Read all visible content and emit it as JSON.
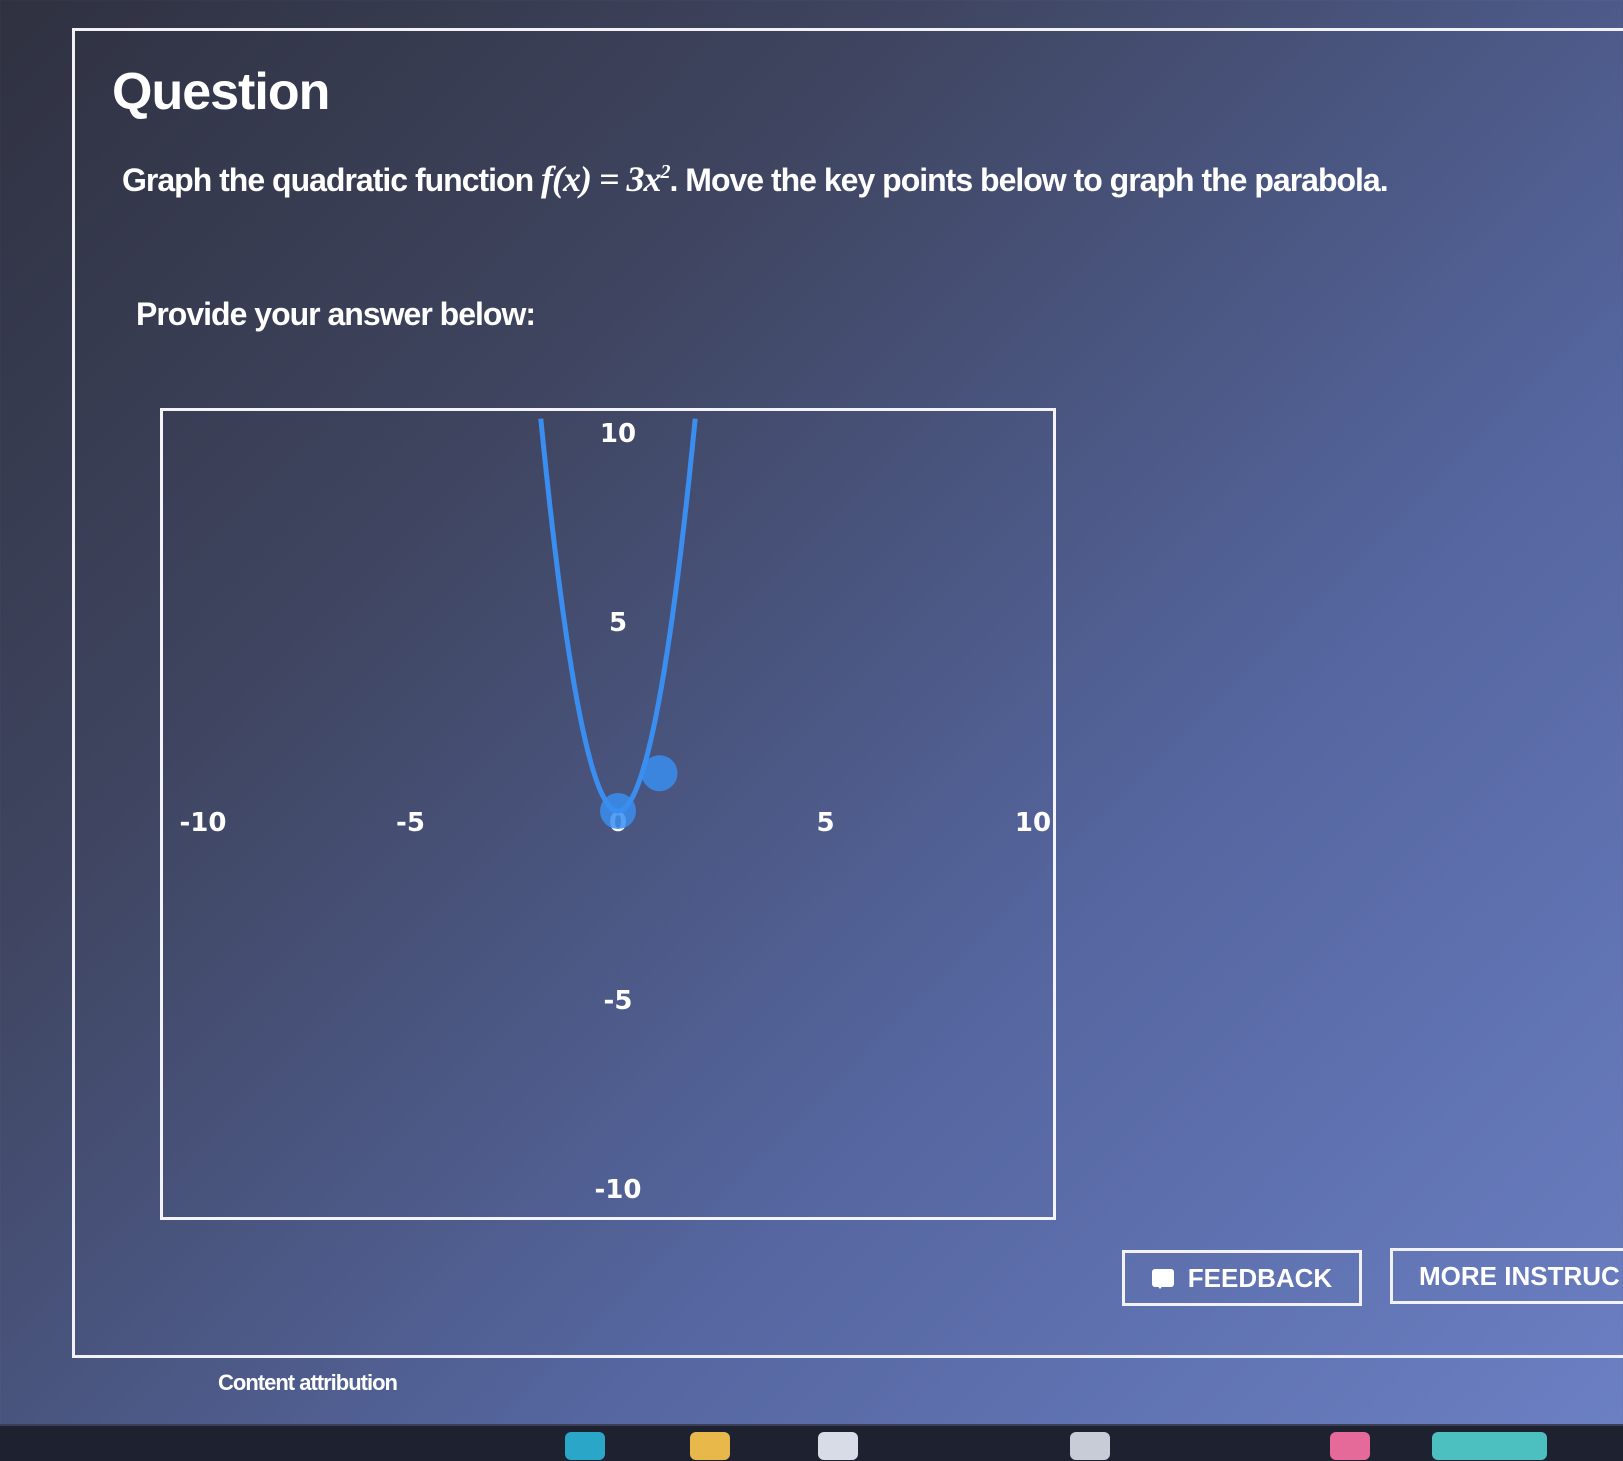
{
  "question": {
    "title": "Question",
    "prompt_before": "Graph the quadratic function ",
    "function_text": "f(x) = 3x",
    "exponent": "2",
    "prompt_after": ". Move the key points below to graph the parabola.",
    "answer_label": "Provide your answer below:"
  },
  "graph": {
    "x_ticks": [
      "-10",
      "-5",
      "0",
      "5",
      "10"
    ],
    "y_ticks": [
      "10",
      "5",
      "-5",
      "-10"
    ],
    "function": {
      "a": 3,
      "h": 0,
      "k": 0
    },
    "key_points": [
      {
        "x": 0,
        "y": 0
      },
      {
        "x": 1,
        "y": 1
      }
    ],
    "curve_color": "#3a8ef0",
    "point_color": "#3a8ef0"
  },
  "buttons": {
    "feedback": "FEEDBACK",
    "more_instructions": "MORE INSTRUC"
  },
  "footer": {
    "attribution": "Content attribution"
  }
}
